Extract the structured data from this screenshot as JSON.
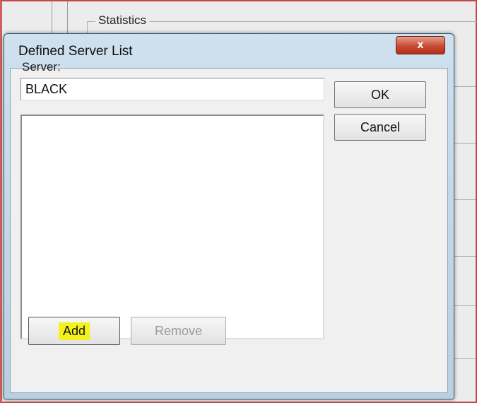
{
  "parent": {
    "group_label": "Statistics"
  },
  "dialog": {
    "title": "Defined Server List",
    "close_label": "x",
    "server_label": "Server:",
    "server_value": "BLACK",
    "server_list_items": [],
    "buttons": {
      "ok": "OK",
      "cancel": "Cancel",
      "add": "Add",
      "remove": "Remove"
    },
    "add_highlight_color": "#f4f21c",
    "close_button_color": "#c94a32"
  }
}
